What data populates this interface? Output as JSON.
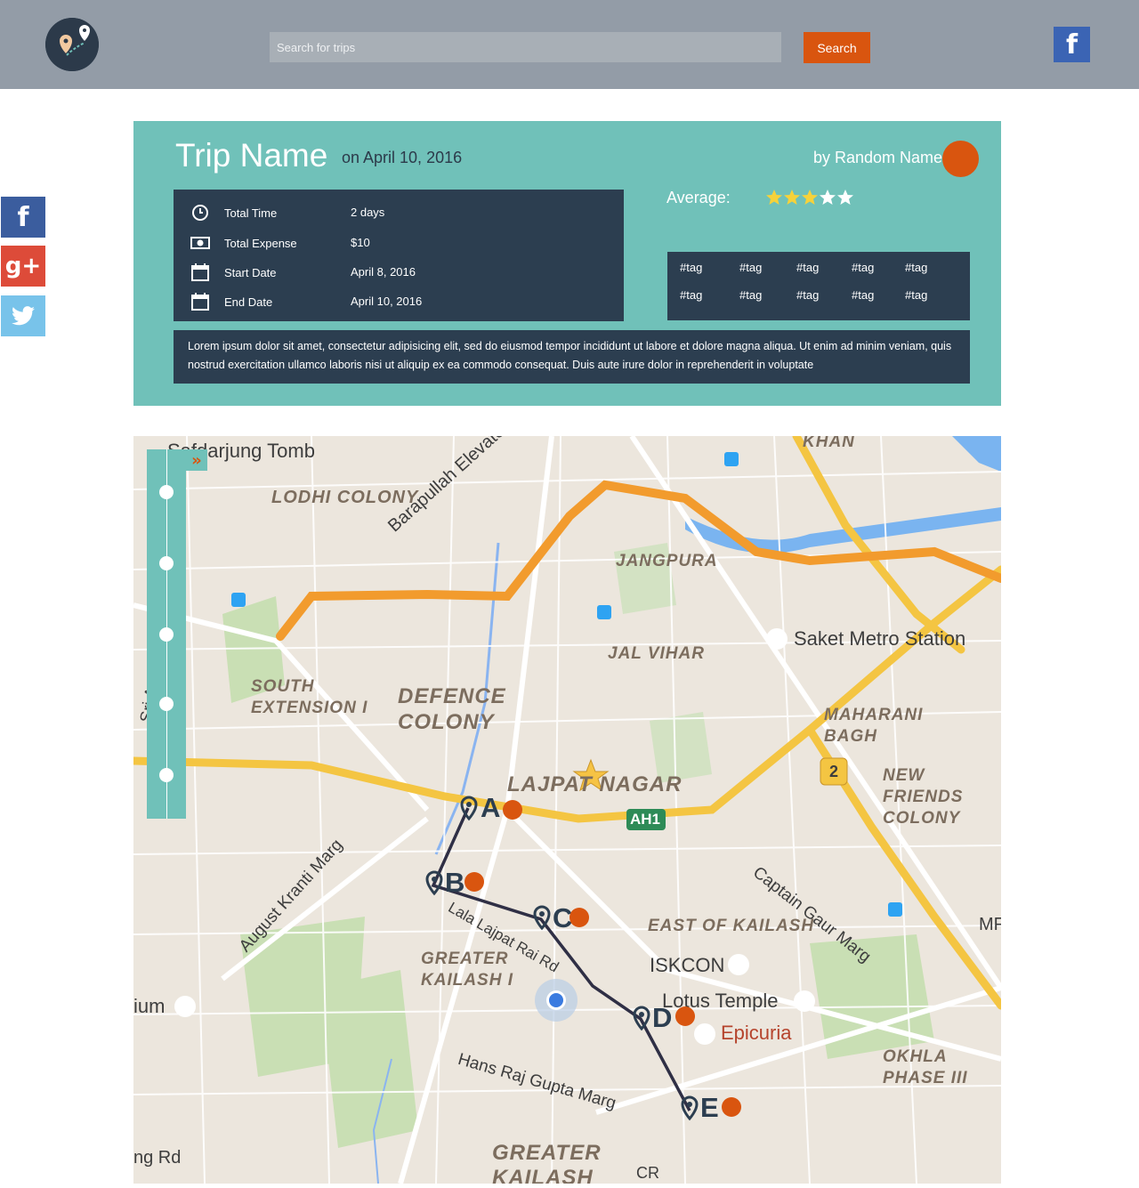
{
  "header": {
    "search_placeholder": "Search for trips",
    "search_button": "Search",
    "facebook_glyph": "f"
  },
  "share": {
    "facebook_glyph": "f",
    "google_glyph": "g+",
    "twitter_icon": "twitter-bird-icon"
  },
  "trip": {
    "title": "Trip Name",
    "date": "on April 10, 2016",
    "author": "by Random Name",
    "details": [
      {
        "icon": "clock-icon",
        "label": "Total Time",
        "value": "2 days"
      },
      {
        "icon": "money-icon",
        "label": "Total Expense",
        "value": "$10"
      },
      {
        "icon": "calendar-icon",
        "label": "Start Date",
        "value": "April 8, 2016"
      },
      {
        "icon": "calendar-icon",
        "label": "End Date",
        "value": "April 10, 2016"
      }
    ],
    "average_label": "Average:",
    "rating": {
      "filled": 3,
      "total": 5
    },
    "tags": [
      "#tag",
      "#tag",
      "#tag",
      "#tag",
      "#tag",
      "#tag",
      "#tag",
      "#tag",
      "#tag",
      "#tag"
    ],
    "description": "Lorem ipsum dolor sit amet, consectetur adipisicing elit, sed do eiusmod tempor incididunt ut labore et dolore magna aliqua. Ut enim ad minim veniam, quis nostrud exercitation ullamco laboris nisi ut aliquip ex ea commodo consequat. Duis aute irure dolor in reprehenderit in voluptate"
  },
  "colors": {
    "accent": "#d9550f",
    "teal": "#70c1b9",
    "dark": "#2c3e50",
    "topbar": "#939ca7"
  },
  "map": {
    "expand_glyph": "»",
    "timeline_stops": 5,
    "stops": [
      "A",
      "B",
      "C",
      "D",
      "E"
    ],
    "places": {
      "safdarjung": "Safdarjung Tomb",
      "lodhi": "LODHI COLONY",
      "jangpura": "JANGPURA",
      "barapullah": "Barapullah Elevated Rd",
      "saket": "Saket Metro Station",
      "jal_vihar": "JAL VIHAR",
      "south_ext": "SOUTH EXTENSION I",
      "defence": "DEFENCE COLONY",
      "maharani": "MAHARANI BAGH",
      "lajpat": "LAJPAT NAGAR",
      "new_friends": "NEW FRIENDS COLONY",
      "ah1": "AH1",
      "route2": "2",
      "august": "August Kranti Marg",
      "captain": "Captain Gaur Marg",
      "east_kailash": "EAST OF KAILASH",
      "iskcon": "ISKCON",
      "lotus": "Lotus Temple",
      "epicuria": "Epicuria",
      "gk1": "GREATER KAILASH I",
      "okhla": "OKHLA PHASE III",
      "hans_raj": "Hans Raj Gupta Marg",
      "gk": "GREATER KAILASH",
      "khan": "KHAN",
      "lala": "Lala Lajpat Rai Rd",
      "ium": "ium",
      "ng_rd": "ng Rd",
      "aurobindo": "Sri Auro",
      "mf": "MF",
      "cr": "CR"
    }
  }
}
